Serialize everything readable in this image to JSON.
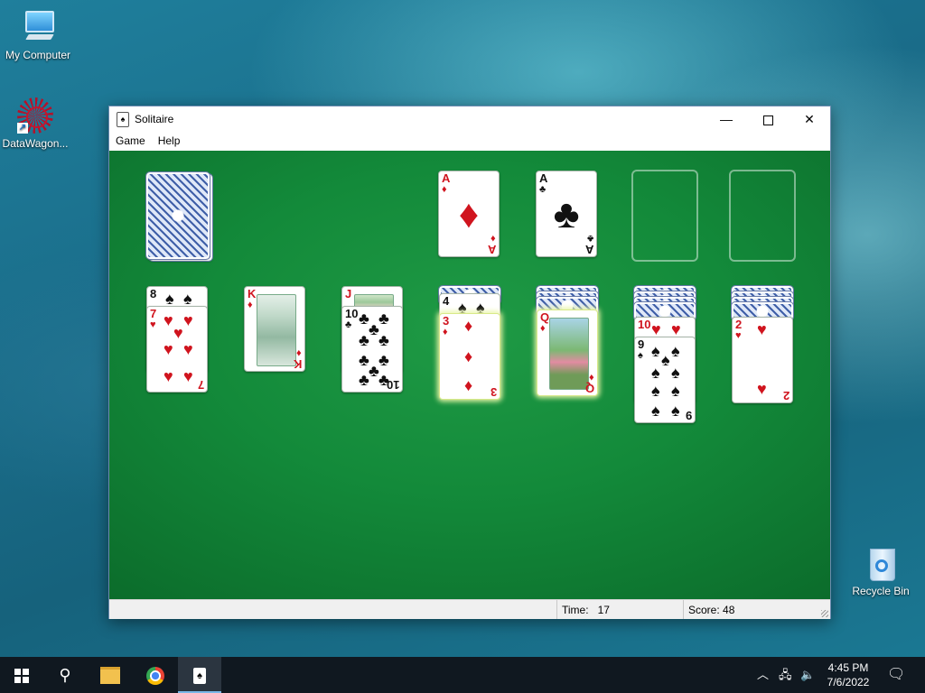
{
  "desktop": {
    "icons": [
      {
        "label": "My Computer",
        "icon": "computer-icon"
      },
      {
        "label": "DataWagon...",
        "icon": "datawagon-icon"
      },
      {
        "label": "Recycle Bin",
        "icon": "recycle-bin-icon"
      }
    ]
  },
  "window": {
    "title": "Solitaire",
    "menu": [
      "Game",
      "Help"
    ],
    "status": {
      "time_label": "Time:",
      "time_value": "17",
      "score": "Score: 48"
    }
  },
  "game": {
    "stock": {
      "count_visible": "back"
    },
    "foundations": [
      {
        "rank": "A",
        "suit": "♦",
        "color": "red"
      },
      {
        "rank": "A",
        "suit": "♣",
        "color": "black"
      },
      {
        "empty": true
      },
      {
        "empty": true
      }
    ],
    "tableau": [
      {
        "hidden": 0,
        "cards": [
          {
            "rank": "8",
            "suit": "♠",
            "color": "black"
          },
          {
            "rank": "7",
            "suit": "♥",
            "color": "red"
          }
        ]
      },
      {
        "hidden": 0,
        "cards": [
          {
            "rank": "K",
            "suit": "♦",
            "color": "red"
          }
        ]
      },
      {
        "hidden": 0,
        "cards": [
          {
            "rank": "J",
            "suit": "♦",
            "color": "red"
          },
          {
            "rank": "10",
            "suit": "♣",
            "color": "black"
          }
        ]
      },
      {
        "hidden": 1,
        "cards": [
          {
            "rank": "4",
            "suit": "♠",
            "color": "black"
          },
          {
            "rank": "3",
            "suit": "♦",
            "color": "red"
          }
        ]
      },
      {
        "hidden": 3,
        "cards": [
          {
            "rank": "Q",
            "suit": "♦",
            "color": "red"
          }
        ]
      },
      {
        "hidden": 4,
        "cards": [
          {
            "rank": "10",
            "suit": "♥",
            "color": "red"
          },
          {
            "rank": "9",
            "suit": "♠",
            "color": "black"
          }
        ]
      },
      {
        "hidden": 4,
        "cards": [
          {
            "rank": "2",
            "suit": "♥",
            "color": "red"
          }
        ]
      }
    ]
  },
  "taskbar": {
    "items": [
      "start-icon",
      "search-icon",
      "file-explorer-icon",
      "chrome-icon",
      "solitaire-icon"
    ],
    "time": "4:45 PM",
    "date": "7/6/2022"
  },
  "colors": {
    "felt": "#138a3a",
    "taskbar": "#101820",
    "red_suit": "#d0141e"
  }
}
